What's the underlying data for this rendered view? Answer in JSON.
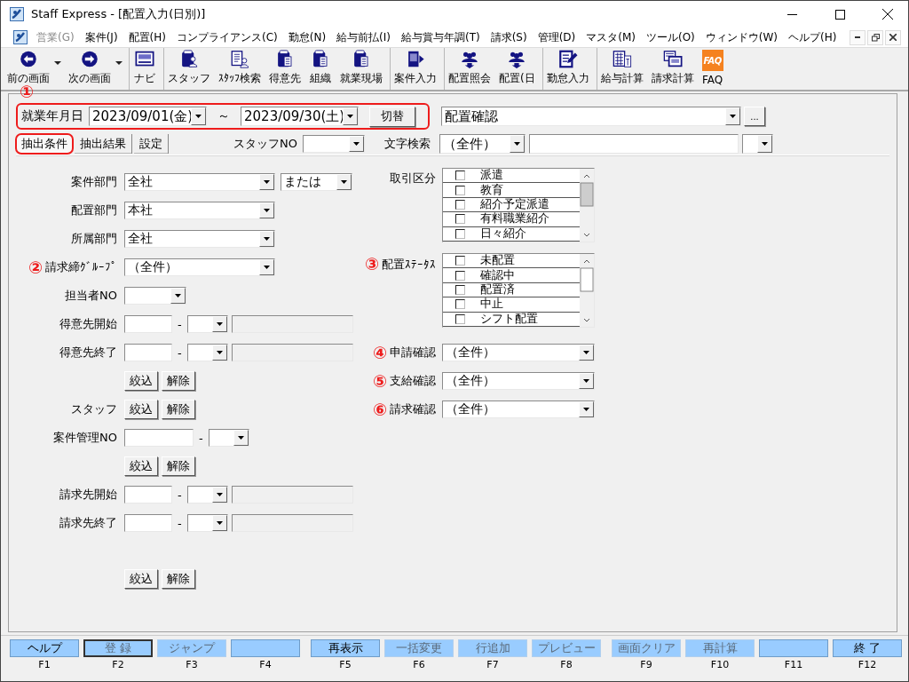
{
  "window": {
    "title": "Staff Express - [配置入力(日別)]"
  },
  "menu": [
    {
      "label": "営業(G)",
      "disabled": true
    },
    {
      "label": "案件(J)",
      "disabled": false
    },
    {
      "label": "配置(H)",
      "disabled": false
    },
    {
      "label": "コンプライアンス(C)",
      "disabled": false
    },
    {
      "label": "勤怠(N)",
      "disabled": false
    },
    {
      "label": "給与前払(I)",
      "disabled": false
    },
    {
      "label": "給与賞与年調(T)",
      "disabled": false
    },
    {
      "label": "請求(S)",
      "disabled": false
    },
    {
      "label": "管理(D)",
      "disabled": false
    },
    {
      "label": "マスタ(M)",
      "disabled": false
    },
    {
      "label": "ツール(O)",
      "disabled": false
    },
    {
      "label": "ウィンドウ(W)",
      "disabled": false
    },
    {
      "label": "ヘルプ(H)",
      "disabled": false
    }
  ],
  "toolbar": [
    {
      "label": "前の画面",
      "dropdown": true,
      "separator_before": false
    },
    {
      "label": "次の画面",
      "dropdown": true,
      "separator_before": false
    },
    {
      "label": "ナビ",
      "dropdown": false,
      "separator_before": true
    },
    {
      "label": "スタッフ",
      "dropdown": false,
      "separator_before": true
    },
    {
      "label": "ｽﾀｯﾌ検索",
      "dropdown": false,
      "separator_before": false
    },
    {
      "label": "得意先",
      "dropdown": false,
      "separator_before": false
    },
    {
      "label": "組織",
      "dropdown": false,
      "separator_before": false
    },
    {
      "label": "就業現場",
      "dropdown": false,
      "separator_before": false
    },
    {
      "label": "案件入力",
      "dropdown": false,
      "separator_before": true
    },
    {
      "label": "配置照会",
      "dropdown": false,
      "separator_before": true
    },
    {
      "label": "配置(日",
      "dropdown": false,
      "separator_before": false
    },
    {
      "label": "勤怠入力",
      "dropdown": false,
      "separator_before": true
    },
    {
      "label": "給与計算",
      "dropdown": false,
      "separator_before": true
    },
    {
      "label": "請求計算",
      "dropdown": false,
      "separator_before": false
    },
    {
      "label": "FAQ",
      "badge": "FAQ",
      "dropdown": false,
      "separator_before": false
    }
  ],
  "period": {
    "marker": "①",
    "highlighted": true,
    "label": "就業年月日",
    "from": "2023/09/01(金)",
    "separator": "～",
    "to": "2023/09/30(土)",
    "switch_button": "切替"
  },
  "view_select": {
    "value": "配置確認",
    "more_button": "..."
  },
  "tabs": [
    {
      "label": "抽出条件",
      "selected": true,
      "highlighted": true
    },
    {
      "label": "抽出結果",
      "selected": false,
      "highlighted": false
    },
    {
      "label": "設定",
      "selected": false,
      "highlighted": false
    }
  ],
  "staff_no": {
    "label": "スタッフNO"
  },
  "text_search": {
    "label": "文字検索",
    "scope": "（全件）"
  },
  "left_form": [
    {
      "kind": "select",
      "label": "案件部門",
      "value": "全社",
      "extra": "または"
    },
    {
      "kind": "select",
      "label": "配置部門",
      "value": "本社"
    },
    {
      "kind": "select",
      "label": "所属部門",
      "value": "全社"
    },
    {
      "kind": "select",
      "label": "請求締ｸﾞﾙｰﾌﾟ",
      "marker": "②",
      "value": "（全件）"
    },
    {
      "kind": "small_select",
      "label": "担当者NO"
    },
    {
      "kind": "range",
      "label": "得意先開始",
      "separator": "-"
    },
    {
      "kind": "range",
      "label": "得意先終了",
      "separator": "-"
    },
    {
      "kind": "buttons",
      "buttons": [
        "絞込",
        "解除"
      ]
    },
    {
      "kind": "buttons",
      "label": "スタッフ",
      "buttons": [
        "絞込",
        "解除"
      ]
    },
    {
      "kind": "code",
      "label": "案件管理NO",
      "separator": "-"
    },
    {
      "kind": "buttons",
      "buttons": [
        "絞込",
        "解除"
      ]
    },
    {
      "kind": "range",
      "label": "請求先開始",
      "separator": "-"
    },
    {
      "kind": "range",
      "label": "請求先終了",
      "separator": "-"
    },
    {
      "kind": "spacer"
    },
    {
      "kind": "buttons",
      "buttons": [
        "絞込",
        "解除"
      ]
    }
  ],
  "right_form": [
    {
      "kind": "list",
      "label": "取引区分",
      "items": [
        {
          "label": "派遣",
          "checked": false
        },
        {
          "label": "教育",
          "checked": false
        },
        {
          "label": "紹介予定派遣",
          "checked": false
        },
        {
          "label": "有料職業紹介",
          "checked": false
        },
        {
          "label": "日々紹介",
          "checked": false
        }
      ]
    },
    {
      "kind": "list",
      "label": "配置ｽﾃｰﾀｽ",
      "marker": "③",
      "items": [
        {
          "label": "未配置",
          "checked": false
        },
        {
          "label": "確認中",
          "checked": false
        },
        {
          "label": "配置済",
          "checked": false
        },
        {
          "label": "中止",
          "checked": false
        },
        {
          "label": "シフト配置",
          "checked": false
        }
      ]
    },
    {
      "kind": "select",
      "label": "申請確認",
      "marker": "④",
      "value": "（全件）"
    },
    {
      "kind": "select",
      "label": "支給確認",
      "marker": "⑤",
      "value": "（全件）"
    },
    {
      "kind": "select",
      "label": "請求確認",
      "marker": "⑥",
      "value": "（全件）"
    }
  ],
  "function_keys": [
    {
      "label": "ヘルプ",
      "key": "F1",
      "disabled": false,
      "focused": false
    },
    {
      "label": "登 録",
      "key": "F2",
      "disabled": true,
      "focused": true
    },
    {
      "label": "ジャンプ",
      "key": "F3",
      "disabled": true,
      "focused": false
    },
    {
      "key": "F4",
      "disabled": false,
      "focused": false
    },
    {
      "label": "再表示",
      "key": "F5",
      "disabled": false,
      "focused": false
    },
    {
      "label": "一括変更",
      "key": "F6",
      "disabled": true,
      "focused": false
    },
    {
      "label": "行追加",
      "key": "F7",
      "disabled": true,
      "focused": false
    },
    {
      "label": "プレビュー",
      "key": "F8",
      "disabled": true,
      "focused": false
    },
    {
      "label": "画面クリア",
      "key": "F9",
      "disabled": true,
      "focused": false
    },
    {
      "label": "再計算",
      "key": "F10",
      "disabled": true,
      "focused": false
    },
    {
      "key": "F11",
      "disabled": false,
      "focused": false
    },
    {
      "label": "終 了",
      "key": "F12",
      "disabled": false,
      "focused": false
    }
  ]
}
